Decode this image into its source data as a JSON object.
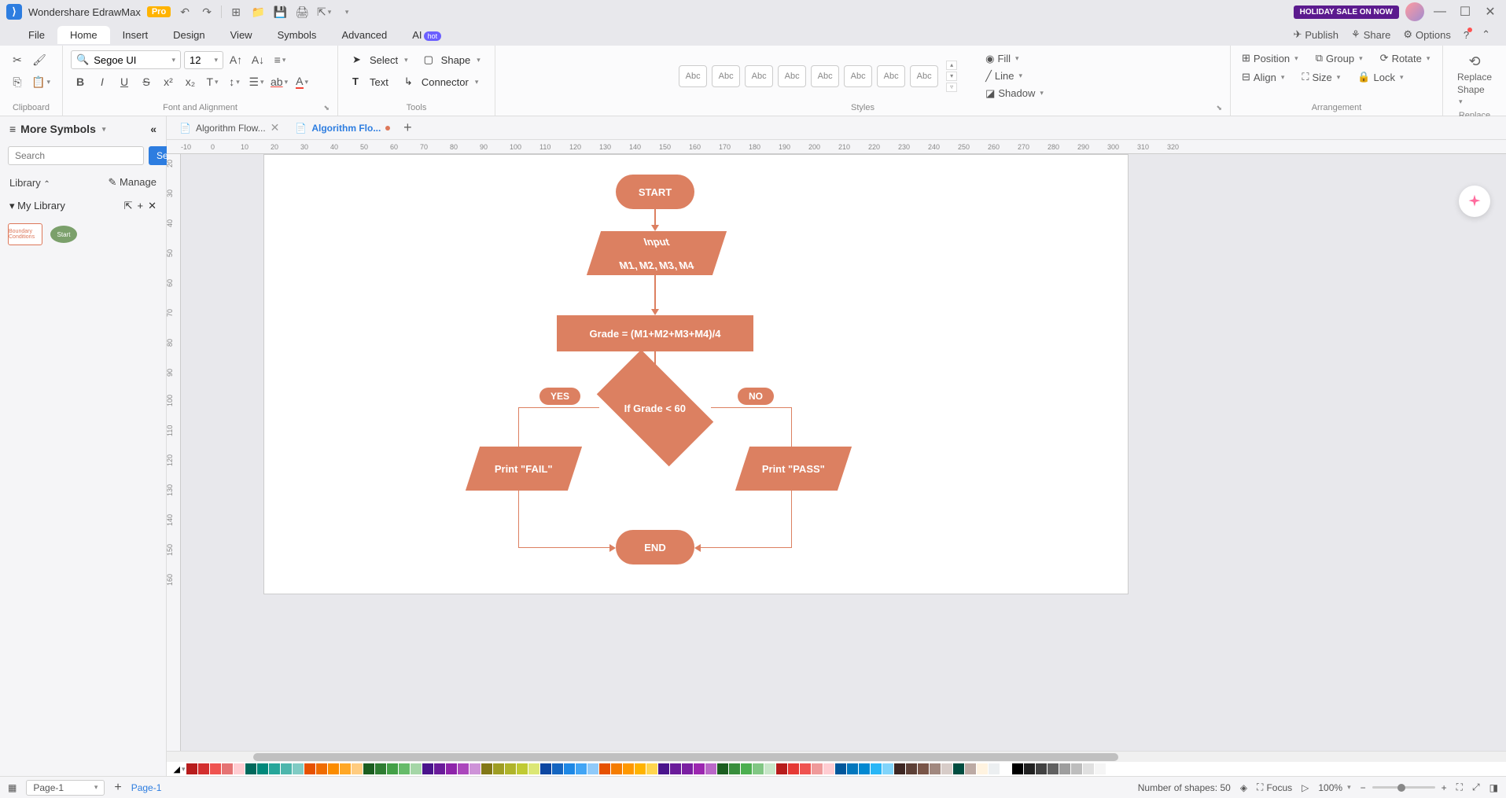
{
  "titlebar": {
    "app_name": "Wondershare EdrawMax",
    "pro_badge": "Pro",
    "holiday": "HOLIDAY SALE ON NOW"
  },
  "menubar": {
    "items": [
      "File",
      "Home",
      "Insert",
      "Design",
      "View",
      "Symbols",
      "Advanced",
      "AI"
    ],
    "ai_badge": "hot",
    "active_index": 1,
    "right": {
      "publish": "Publish",
      "share": "Share",
      "options": "Options"
    }
  },
  "ribbon": {
    "clipboard_label": "Clipboard",
    "font_family": "Segoe UI",
    "font_size": "12",
    "font_label": "Font and Alignment",
    "tools": {
      "select": "Select",
      "text": "Text",
      "shape": "Shape",
      "connector": "Connector",
      "label": "Tools"
    },
    "styles": {
      "swatch": "Abc",
      "label": "Styles"
    },
    "fill": "Fill",
    "line": "Line",
    "shadow": "Shadow",
    "position": "Position",
    "group": "Group",
    "rotate": "Rotate",
    "align": "Align",
    "size": "Size",
    "lock": "Lock",
    "arrangement_label": "Arrangement",
    "replace": {
      "line1": "Replace",
      "line2": "Shape",
      "label": "Replace"
    }
  },
  "left_panel": {
    "header": "More Symbols",
    "search_placeholder": "Search",
    "search_btn": "Search",
    "library_label": "Library",
    "manage_label": "Manage",
    "my_library": "My Library",
    "thumbs": [
      "Boundary Conditions",
      "Start"
    ]
  },
  "doc_tabs": {
    "tabs": [
      {
        "label": "Algorithm Flow...",
        "active": false,
        "modified": false
      },
      {
        "label": "Algorithm Flo...",
        "active": true,
        "modified": true
      }
    ]
  },
  "ruler_h": [
    "-10",
    "0",
    "10",
    "20",
    "30",
    "40",
    "50",
    "60",
    "70",
    "80",
    "90",
    "100",
    "110",
    "120",
    "130",
    "140",
    "150",
    "160",
    "170",
    "180",
    "190",
    "200",
    "210",
    "220",
    "230",
    "240",
    "250",
    "260",
    "270",
    "280",
    "290",
    "300",
    "310",
    "320"
  ],
  "ruler_v": [
    "20",
    "30",
    "40",
    "50",
    "60",
    "70",
    "80",
    "90",
    "100",
    "110",
    "120",
    "130",
    "140",
    "150",
    "160"
  ],
  "flowchart": {
    "start": "START",
    "input_line1": "Input",
    "input_line2": "M1, M2, M3, M4",
    "process": "Grade = (M1+M2+M3+M4)/4",
    "decision": "If Grade < 60",
    "yes": "YES",
    "no": "NO",
    "fail": "Print \"FAIL\"",
    "pass": "Print \"PASS\"",
    "end": "END"
  },
  "colorbar_hexes": [
    "#b71c1c",
    "#d32f2f",
    "#ef5350",
    "#e57373",
    "#ffcdd2",
    "#00695c",
    "#00897b",
    "#26a69a",
    "#4db6ac",
    "#80cbc4",
    "#e65100",
    "#ef6c00",
    "#fb8c00",
    "#ffa726",
    "#ffcc80",
    "#1b5e20",
    "#2e7d32",
    "#43a047",
    "#66bb6a",
    "#a5d6a7",
    "#4a148c",
    "#6a1b9a",
    "#8e24aa",
    "#ab47bc",
    "#ce93d8",
    "#827717",
    "#9e9d24",
    "#afb42b",
    "#c0ca33",
    "#dce775",
    "#0d47a1",
    "#1565c0",
    "#1e88e5",
    "#42a5f5",
    "#90caf9",
    "#e65100",
    "#f57c00",
    "#ff9800",
    "#ffb300",
    "#ffd54f",
    "#4a148c",
    "#6a1b9a",
    "#7b1fa2",
    "#9c27b0",
    "#ba68c8",
    "#1b5e20",
    "#388e3c",
    "#4caf50",
    "#81c784",
    "#c8e6c9",
    "#b71c1c",
    "#e53935",
    "#ef5350",
    "#ef9a9a",
    "#ffcdd2",
    "#01579b",
    "#0277bd",
    "#0288d1",
    "#29b6f6",
    "#81d4fa",
    "#3e2723",
    "#5d4037",
    "#795548",
    "#a1887f",
    "#d7ccc8",
    "#004d40",
    "#bcaaa4",
    "#fff3e0",
    "#eceff1",
    "#ffffff",
    "#000000",
    "#212121",
    "#424242",
    "#616161",
    "#9e9e9e",
    "#bdbdbd",
    "#e0e0e0",
    "#f5f5f5",
    "#ffffff"
  ],
  "statusbar": {
    "page_selector": "Page-1",
    "page_link": "Page-1",
    "shapes": "Number of shapes: 50",
    "focus": "Focus",
    "zoom": "100%"
  }
}
